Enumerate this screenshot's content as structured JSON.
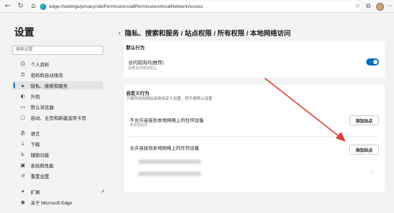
{
  "toolbar": {
    "back_icon": "back-arrow-icon",
    "refresh_icon": "refresh-icon",
    "home_icon": "home-icon",
    "url": "edge://settings/privacy/sitePermissions/allPermissions/localNetworkAccess",
    "star_icon": "favorite-star-icon",
    "collections_icon": "collections-icon",
    "more_icon": "more-menu-icon"
  },
  "sidebar": {
    "title": "设置",
    "search_placeholder": "搜索设置",
    "items": [
      {
        "label": "个人资料",
        "icon": "profile-icon"
      },
      {
        "label": "密码和自动填充",
        "icon": "key-icon"
      },
      {
        "label": "隐私、搜索和服务",
        "icon": "lock-icon",
        "active": true
      },
      {
        "label": "外观",
        "icon": "appearance-icon"
      },
      {
        "label": "默认浏览器",
        "icon": "browser-icon"
      },
      {
        "label": "启动、主页和新建选项卡页",
        "icon": "start-page-icon"
      },
      {
        "label": "语言",
        "icon": "language-icon"
      },
      {
        "label": "下载",
        "icon": "download-icon"
      },
      {
        "label": "辅助功能",
        "icon": "accessibility-icon"
      },
      {
        "label": "系统和性能",
        "icon": "system-icon"
      },
      {
        "label": "重置设置",
        "icon": "reset-icon"
      },
      {
        "label": "扩展",
        "icon": "extensions-icon"
      },
      {
        "label": "关于 Microsoft Edge",
        "icon": "edge-icon"
      }
    ]
  },
  "main": {
    "title": "隐私、搜索和服务 / 站点权限 / 所有权限 / 本地网络访问",
    "default_behavior": {
      "section_title": "默认行为",
      "row_title": "访问前询问(推荐)",
      "row_sub": "如果关闭将会阻止",
      "toggle_on": true
    },
    "custom_behavior": {
      "section_title": "自定义行为",
      "section_sub": "下面列出的网站采用自定义设置，而不是默认设置",
      "block": {
        "title": "不允许连接到本地网络上的任何设备",
        "sub": "未添加站点",
        "button": "添加站点"
      },
      "allow": {
        "title": "允许连接到本地网络上的任何设备",
        "button": "添加站点"
      }
    }
  },
  "colors": {
    "accent": "#0f6cbd",
    "annotation_arrow": "#e0403a"
  }
}
